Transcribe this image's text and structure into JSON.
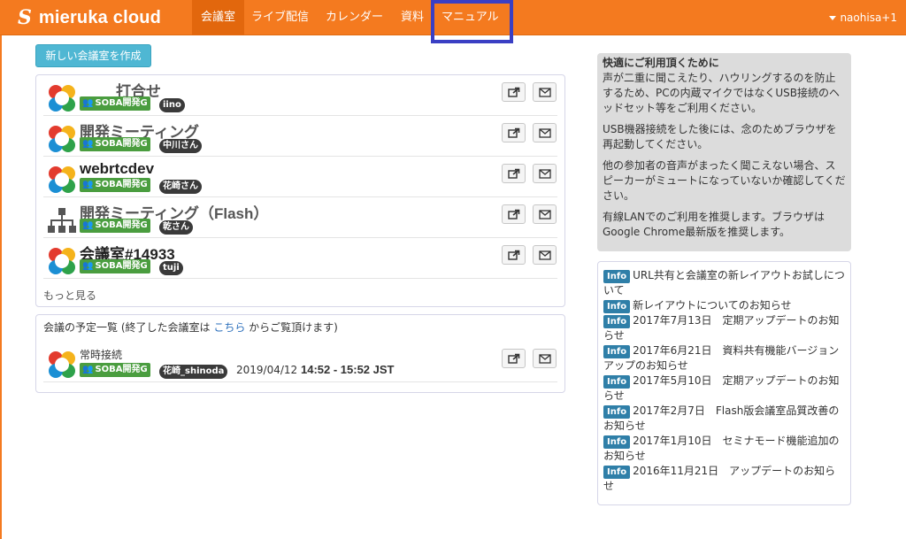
{
  "navbar": {
    "logo_glyph": "S",
    "brand": "mieruka cloud",
    "items": [
      "会議室",
      "ライブ配信",
      "カレンダー",
      "資料",
      "マニュアル"
    ],
    "active_index": 0,
    "user": "naohisa+1"
  },
  "colors": {
    "navbar": "#f47a1f",
    "tag_group": "#4a9d3f",
    "info_label": "#2f7fa8",
    "highlight": "#3a3fc4"
  },
  "create_button": "新しい会議室を作成",
  "rooms": [
    {
      "name": "打合せ",
      "group": "SOBA開発G",
      "user": "iino",
      "icon": "webrtc-logo-icon"
    },
    {
      "name": "開発ミーティング",
      "group": "SOBA開発G",
      "user": "中川さん",
      "icon": "webrtc-logo-icon"
    },
    {
      "name": "webrtcdev",
      "group": "SOBA開発G",
      "user": "花崎さん",
      "icon": "webrtc-logo-icon"
    },
    {
      "name": "開発ミーティング（Flash）",
      "group": "SOBA開発G",
      "user": "乾さん",
      "icon": "org-chart-icon"
    },
    {
      "name": "会議室#14933",
      "group": "SOBA開発G",
      "user": "tuji",
      "icon": "webrtc-logo-icon"
    }
  ],
  "more_link": "もっと見る",
  "schedule": {
    "title_prefix": "会議の予定一覧 (終了した会議室は ",
    "title_link": "こちら",
    "title_suffix": " からご覧頂けます)",
    "room_name": "常時接続",
    "group": "SOBA開発G",
    "user": "花崎_shinoda",
    "date": "2019/04/12 ",
    "time": "14:52 - 15:52 JST"
  },
  "tips": {
    "title": "快適にご利用頂くために",
    "paragraphs": [
      "声が二重に聞こえたり、ハウリングするのを防止するため、PCの内蔵マイクではなくUSB接続のヘッドセット等をご利用ください。",
      "USB機器接続をした後には、念のためブラウザを再起動してください。",
      "他の参加者の音声がまったく聞こえない場合、スピーカーがミュートになっていないか確認してください。",
      "有線LANでのご利用を推奨します。ブラウザはGoogle Chrome最新版を推奨します。"
    ]
  },
  "info": {
    "label": "Info",
    "items": [
      "URL共有と会議室の新レイアウトお試しについて",
      "新レイアウトについてのお知らせ",
      "2017年7月13日　定期アップデートのお知らせ",
      "2017年6月21日　資料共有機能バージョンアップのお知らせ",
      "2017年5月10日　定期アップデートのお知らせ",
      "2017年2月7日　Flash版会議室品質改善のお知らせ",
      "2017年1月10日　セミナモード機能追加のお知らせ",
      "2016年11月21日　アップデートのお知らせ"
    ]
  }
}
